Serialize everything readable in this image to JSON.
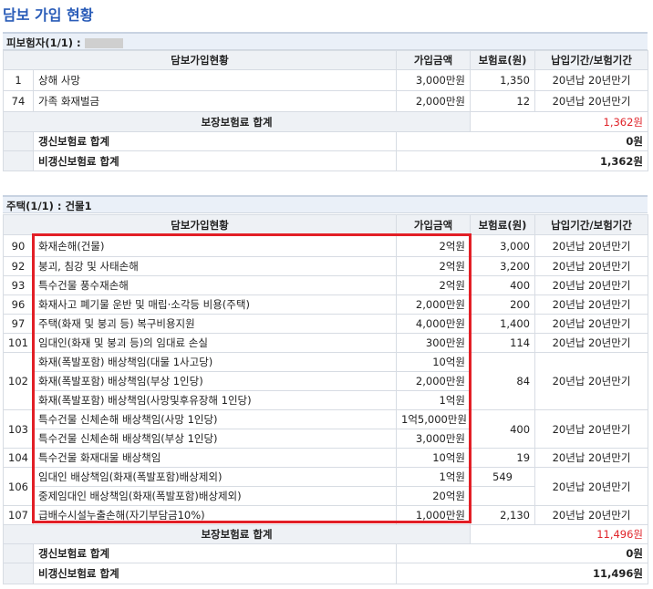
{
  "page_title": "담보 가입 현황",
  "section1": {
    "header": "피보험자(1/1) :",
    "columns": [
      "담보가입현황",
      "가입금액",
      "보험료(원)",
      "납입기간/보험기간"
    ],
    "rows": [
      {
        "no": "1",
        "name": "상해 사망",
        "amount": "3,000만원",
        "premium": "1,350",
        "period": "20년납 20년만기"
      },
      {
        "no": "74",
        "name": "가족 화재벌금",
        "amount": "2,000만원",
        "premium": "12",
        "period": "20년납 20년만기"
      }
    ],
    "total_label": "보장보험료 합계",
    "total_value": "1,362원",
    "renew_label": "갱신보험료 합계",
    "renew_value": "0원",
    "nonrenew_label": "비갱신보험료 합계",
    "nonrenew_value": "1,362원"
  },
  "section2": {
    "header": "주택(1/1) : 건물1",
    "columns": [
      "담보가입현황",
      "가입금액",
      "보험료(원)",
      "납입기간/보험기간"
    ],
    "rows": [
      {
        "no": "90",
        "name": "화재손해(건물)",
        "amount": "2억원",
        "premium": "3,000",
        "period": "20년납 20년만기"
      },
      {
        "no": "92",
        "name": "붕괴, 침강 및 사태손해",
        "amount": "2억원",
        "premium": "3,200",
        "period": "20년납 20년만기"
      },
      {
        "no": "93",
        "name": "특수건물 풍수재손해",
        "amount": "2억원",
        "premium": "400",
        "period": "20년납 20년만기"
      },
      {
        "no": "96",
        "name": "화재사고 폐기물 운반 및 매립·소각등 비용(주택)",
        "amount": "2,000만원",
        "premium": "200",
        "period": "20년납 20년만기"
      },
      {
        "no": "97",
        "name": "주택(화재 및 붕괴 등) 복구비용지원",
        "amount": "4,000만원",
        "premium": "1,400",
        "period": "20년납 20년만기"
      },
      {
        "no": "101",
        "name": "임대인(화재 및 붕괴 등)의 임대료 손실",
        "amount": "300만원",
        "premium": "114",
        "period": "20년납 20년만기"
      }
    ],
    "group102": {
      "no": "102",
      "items": [
        {
          "name": "화재(폭발포함) 배상책임(대물 1사고당)",
          "amount": "10억원"
        },
        {
          "name": "화재(폭발포함) 배상책임(부상 1인당)",
          "amount": "2,000만원"
        },
        {
          "name": "화재(폭발포함) 배상책임(사망및후유장해 1인당)",
          "amount": "1억원"
        }
      ],
      "premium": "84",
      "period": "20년납 20년만기"
    },
    "group103": {
      "no": "103",
      "items": [
        {
          "name": "특수건물 신체손해 배상책임(사망 1인당)",
          "amount": "1억5,000만원"
        },
        {
          "name": "특수건물 신체손해 배상책임(부상 1인당)",
          "amount": "3,000만원"
        }
      ],
      "premium": "400",
      "period": "20년납 20년만기"
    },
    "row104": {
      "no": "104",
      "name": "특수건물 화재대물 배상책임",
      "amount": "10억원",
      "premium": "19",
      "period": "20년납 20년만기"
    },
    "group106": {
      "no": "106",
      "items": [
        {
          "name": "임대인 배상책임(화재(폭발포함)배상제외)",
          "amount": "1억원"
        },
        {
          "name": "중제임대인 배상책임(화재(폭발포함)배상제외)",
          "amount": "20억원"
        }
      ],
      "premium": "549",
      "period": "20년납 20년만기"
    },
    "row107": {
      "no": "107",
      "name": "급배수시설누출손해(자기부담금10%)",
      "amount": "1,000만원",
      "premium": "2,130",
      "period": "20년납 20년만기"
    },
    "total_label": "보장보험료 합계",
    "total_value": "11,496원",
    "renew_label": "갱신보험료 합계",
    "renew_value": "0원",
    "nonrenew_label": "비갱신보험료 합계",
    "nonrenew_value": "11,496원"
  },
  "colors": {
    "title": "#2a5cb8",
    "total_red": "#e0242a",
    "highlight_border": "#e21f26"
  }
}
